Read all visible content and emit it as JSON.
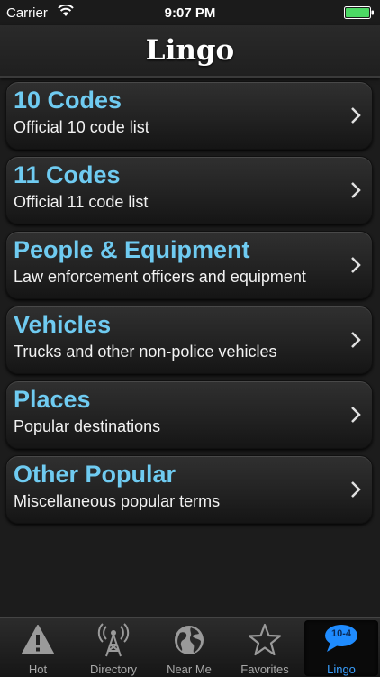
{
  "status_bar": {
    "carrier": "Carrier",
    "time": "9:07 PM",
    "icons": [
      "wifi-icon",
      "battery-icon"
    ]
  },
  "nav": {
    "title": "Lingo"
  },
  "items": [
    {
      "title": "10 Codes",
      "subtitle": "Official 10 code list"
    },
    {
      "title": "11 Codes",
      "subtitle": "Official 11 code list"
    },
    {
      "title": "People & Equipment",
      "subtitle": "Law enforcement officers and equipment"
    },
    {
      "title": "Vehicles",
      "subtitle": "Trucks and other non-police vehicles"
    },
    {
      "title": "Places",
      "subtitle": "Popular destinations"
    },
    {
      "title": "Other Popular",
      "subtitle": "Miscellaneous popular terms"
    }
  ],
  "tabs": [
    {
      "label": "Hot",
      "icon": "warning-icon",
      "active": false
    },
    {
      "label": "Directory",
      "icon": "radio-tower-icon",
      "active": false
    },
    {
      "label": "Near Me",
      "icon": "globe-icon",
      "active": false
    },
    {
      "label": "Favorites",
      "icon": "star-icon",
      "active": false
    },
    {
      "label": "Lingo",
      "icon": "speech-bubble-icon",
      "badge": "10-4",
      "active": true
    }
  ],
  "colors": {
    "accent_title": "#6fcbf1",
    "active_tab": "#3aa0ff",
    "battery": "#4cd964"
  }
}
